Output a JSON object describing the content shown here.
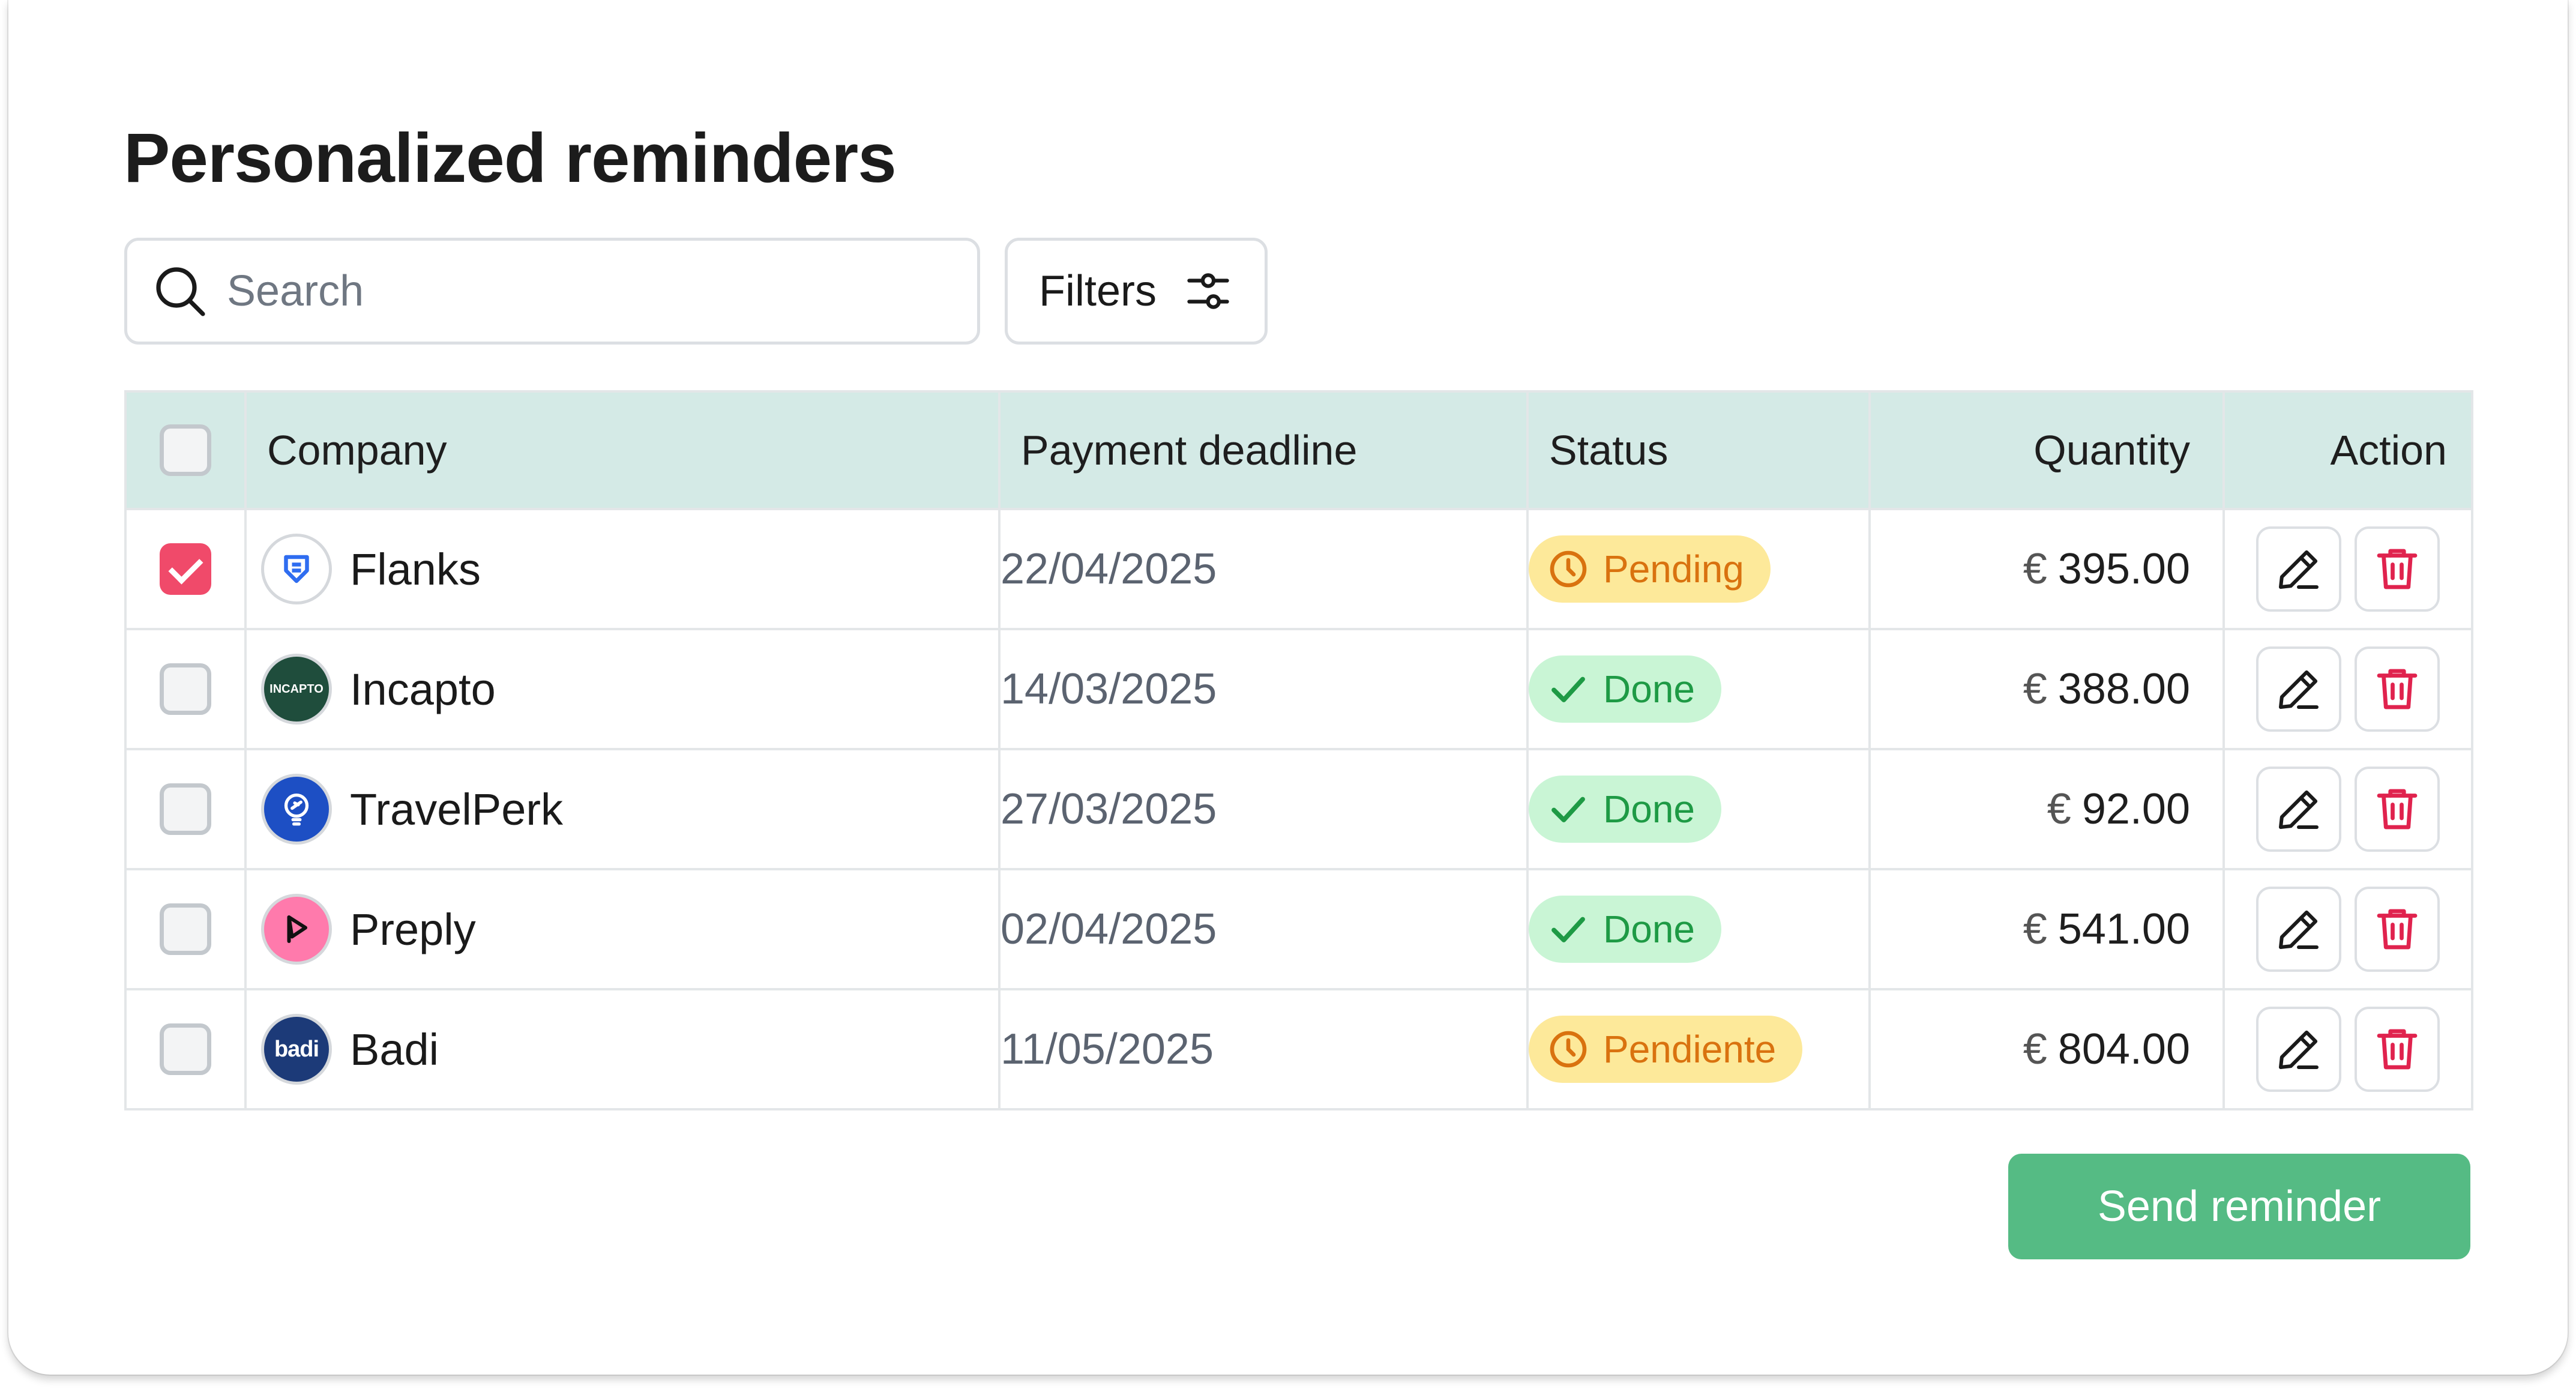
{
  "page": {
    "title": "Personalized reminders"
  },
  "search": {
    "placeholder": "Search",
    "value": "",
    "icon": "search-icon"
  },
  "filters": {
    "label": "Filters",
    "icon": "sliders-icon"
  },
  "table": {
    "headers": {
      "company": "Company",
      "payment_deadline": "Payment deadline",
      "status": "Status",
      "quantity": "Quantity",
      "action": "Action"
    },
    "rows": [
      {
        "checked": true,
        "company": "Flanks",
        "logo": "flanks-logo",
        "deadline": "22/04/2025",
        "status": "Pending",
        "status_type": "pending",
        "currency": "€",
        "amount": "395.00"
      },
      {
        "checked": false,
        "company": "Incapto",
        "logo": "incapto-logo",
        "logo_text": "INCAPTO",
        "deadline": "14/03/2025",
        "status": "Done",
        "status_type": "done",
        "currency": "€",
        "amount": "388.00"
      },
      {
        "checked": false,
        "company": "TravelPerk",
        "logo": "travelperk-logo",
        "deadline": "27/03/2025",
        "status": "Done",
        "status_type": "done",
        "currency": "€",
        "amount": "92.00"
      },
      {
        "checked": false,
        "company": "Preply",
        "logo": "preply-logo",
        "deadline": "02/04/2025",
        "status": "Done",
        "status_type": "done",
        "currency": "€",
        "amount": "541.00"
      },
      {
        "checked": false,
        "company": "Badi",
        "logo": "badi-logo",
        "logo_text": "badi",
        "deadline": "11/05/2025",
        "status": "Pendiente",
        "status_type": "pending",
        "currency": "€",
        "amount": "804.00"
      }
    ]
  },
  "send_button": {
    "label": "Send reminder"
  },
  "colors": {
    "header_bg": "#d4eae6",
    "checkbox_checked": "#f04a6a",
    "pending_bg": "#fde99a",
    "pending_text": "#d9720f",
    "done_bg": "#c9f5d5",
    "done_text": "#1e9a45",
    "delete_icon": "#e0234e",
    "send_button": "#55bb84"
  }
}
